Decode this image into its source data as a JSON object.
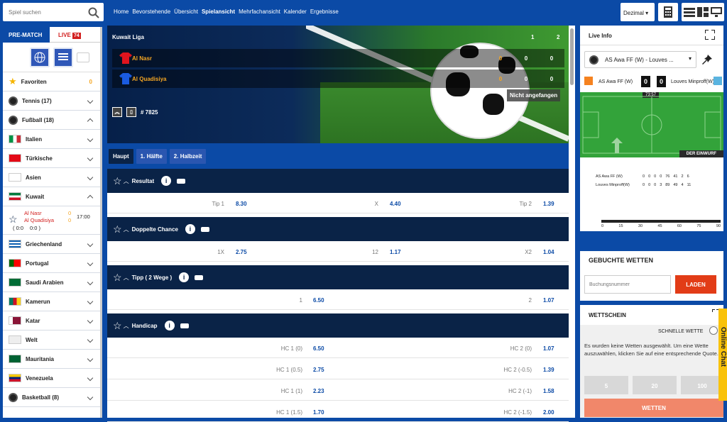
{
  "search": {
    "placeholder": "Spiel suchen"
  },
  "nav": [
    "Home",
    "Bevorstehende",
    "Übersicht",
    "Spielansicht",
    "Mehrfachansicht",
    "Kalender",
    "Ergebnisse"
  ],
  "nav_active": "Spielansicht",
  "odds_format": "Dezimal",
  "sidebar": {
    "tab_prematch": "PRE-MATCH",
    "tab_live": "LIVE",
    "live_count": "74",
    "items": [
      {
        "label": "Favoriten",
        "count": "0"
      },
      {
        "label": "Tennis (17)"
      },
      {
        "label": "Fußball (18)"
      },
      {
        "label": "Italien"
      },
      {
        "label": "Türkische"
      },
      {
        "label": "Asien"
      },
      {
        "label": "Kuwait"
      },
      {
        "label": "Griechenland"
      },
      {
        "label": "Portugal"
      },
      {
        "label": "Saudi Arabien"
      },
      {
        "label": "Kamerun"
      },
      {
        "label": "Katar"
      },
      {
        "label": "Welt"
      },
      {
        "label": "Mauritania"
      },
      {
        "label": "Venezuela"
      },
      {
        "label": "Basketball (8)"
      }
    ],
    "match": {
      "home": "Al Nasr",
      "away": "Al Quadisiya",
      "home_score": "0",
      "away_score": "0",
      "time": "17:00",
      "ht1": "( 0:0 ",
      "ht2": "0:0 )"
    }
  },
  "hero": {
    "league": "Kuwait Liga",
    "h1": "1",
    "h2": "2",
    "home": "Al Nasr",
    "away": "Al Quadisiya",
    "home_s": [
      "0",
      "0",
      "0"
    ],
    "away_s": [
      "0",
      "0",
      "0"
    ],
    "status": "Nicht angefangen",
    "id": "# 7825"
  },
  "tabs": [
    "Haupt",
    "1. Hälfte",
    "2. Halbzeit"
  ],
  "markets": [
    {
      "name": "Resultat",
      "rows": [
        {
          "l1": "Tip 1",
          "o1": "8.30",
          "l2": "X",
          "o2": "4.40",
          "l3": "Tip 2",
          "o3": "1.39"
        }
      ]
    },
    {
      "name": "Doppelte Chance",
      "rows": [
        {
          "l1": "1X",
          "o1": "2.75",
          "l2": "12",
          "o2": "1.17",
          "l3": "X2",
          "o3": "1.04"
        }
      ]
    },
    {
      "name": "Tipp ( 2 Wege )",
      "rows": [
        {
          "l1": "1",
          "o1": "6.50",
          "l3": "2",
          "o3": "1.07"
        }
      ]
    },
    {
      "name": "Handicap",
      "rows": [
        {
          "l1": "HC 1 (0)",
          "o1": "6.50",
          "l3": "HC 2 (0)",
          "o3": "1.07"
        },
        {
          "l1": "HC 1 (0.5)",
          "o1": "2.75",
          "l3": "HC 2 (-0.5)",
          "o3": "1.39"
        },
        {
          "l1": "HC 1 (1)",
          "o1": "2.23",
          "l3": "HC 2 (-1)",
          "o3": "1.58"
        },
        {
          "l1": "HC 1 (1.5)",
          "o1": "1.70",
          "l3": "HC 2 (-1.5)",
          "o3": "2.00"
        }
      ]
    }
  ],
  "right": {
    "live_info": "Live Info",
    "match_select": "AS Awa FF (W) - Louves ...",
    "home": "AS Awa FF (W)",
    "away": "Louves Minproff(W)",
    "hs": "0",
    "as": "0",
    "clock": "73:57",
    "event": "DER EINWURF",
    "stat_home": "AS Awa FF (W)",
    "stat_away": "Louves Minproff(W)",
    "stat_home_vals": [
      "0",
      "0",
      "0",
      "0",
      "76",
      "41",
      "2",
      "6"
    ],
    "stat_away_vals": [
      "0",
      "0",
      "0",
      "3",
      "89",
      "49",
      "4",
      "11"
    ],
    "timeline": [
      "0",
      "15",
      "30",
      "45",
      "60",
      "75",
      "90"
    ],
    "gebucht_title": "GEBUCHTE WETTEN",
    "booking_placeholder": "Buchungsnummer",
    "load_btn": "LADEN",
    "wettschein": "WETTSCHEIN",
    "schnelle": "SCHNELLE WETTE",
    "empty_msg": "Es wurden keine Wetten ausgewählt. Um eine Wette auszuwählen, klicken Sie auf eine entsprechende Quote.",
    "stakes": [
      "5",
      "20",
      "100"
    ],
    "place_btn": "WETTEN"
  },
  "chat": "Online Chat"
}
